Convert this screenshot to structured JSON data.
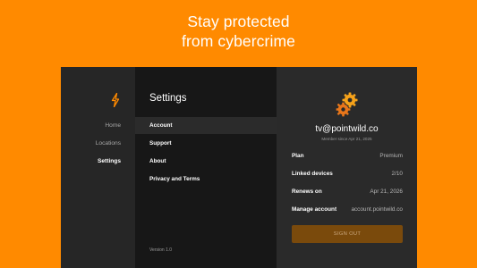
{
  "banner": {
    "line1": "Stay protected",
    "line2": "from cybercrime"
  },
  "nav": {
    "logo_icon": "lightning-bolt-icon",
    "items": [
      {
        "label": "Home",
        "active": false
      },
      {
        "label": "Locations",
        "active": false
      },
      {
        "label": "Settings",
        "active": true
      }
    ]
  },
  "settings": {
    "title": "Settings",
    "menu": [
      {
        "label": "Account",
        "selected": true
      },
      {
        "label": "Support",
        "selected": false
      },
      {
        "label": "About",
        "selected": false
      },
      {
        "label": "Privacy and Terms",
        "selected": false
      }
    ],
    "version": "Version 1.0"
  },
  "account": {
    "avatar_icon": "gears-icon",
    "email": "tv@pointwild.co",
    "member_since": "Member since Apr 21, 2025",
    "rows": [
      {
        "key": "Plan",
        "value": "Premium"
      },
      {
        "key": "Linked devices",
        "value": "2/10"
      },
      {
        "key": "Renews on",
        "value": "Apr 21, 2026"
      },
      {
        "key": "Manage account",
        "value": "account.pointwild.co"
      }
    ],
    "sign_out_label": "SIGN OUT"
  },
  "colors": {
    "brand_orange": "#FF8A00",
    "sign_out_bg": "#7A4A0C"
  }
}
